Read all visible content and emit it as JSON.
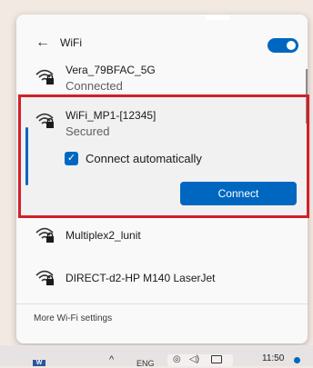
{
  "header": {
    "title": "WiFi",
    "back_label": "←"
  },
  "networks": [
    {
      "name": "Vera_79BFAC_5G",
      "status": "Connected"
    },
    {
      "name": "WiFi_MP1-[12345]",
      "status": "Secured"
    },
    {
      "name": "Multiplex2_lunit",
      "status": ""
    },
    {
      "name": "DIRECT-d2-HP M140 LaserJet",
      "status": ""
    }
  ],
  "selected": {
    "connect_auto_label": "Connect automatically",
    "connect_auto_checked": true,
    "connect_button": "Connect"
  },
  "footer": {
    "more_settings": "More Wi-Fi settings"
  },
  "taskbar": {
    "word_icon": "W",
    "lang": "ENG",
    "time": "11:50",
    "caret": "^"
  },
  "colors": {
    "accent": "#0067c0",
    "highlight": "#d12029"
  },
  "icons": {
    "wifi": "wifi-secured-icon",
    "back": "back-arrow-icon",
    "check": "checkmark-icon"
  }
}
